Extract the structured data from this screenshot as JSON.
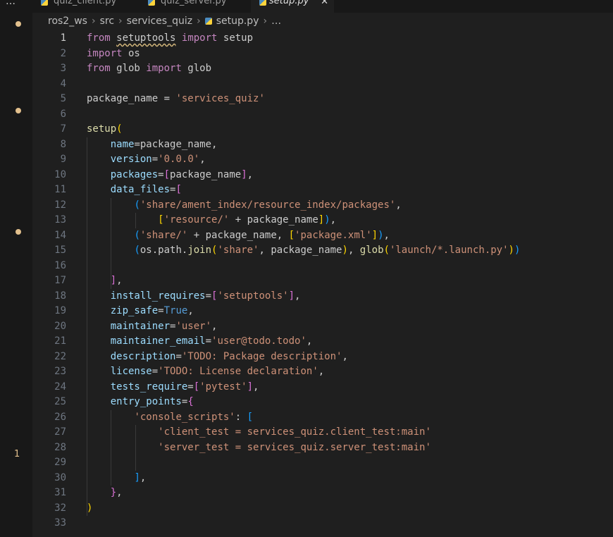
{
  "tabs": [
    {
      "name": "quiz_client.py"
    },
    {
      "name": "quiz_server.py"
    },
    {
      "name": "setup.py"
    }
  ],
  "more_label": "…",
  "close_glyph": "✕",
  "activity_badge": "1",
  "breadcrumb": [
    "ros2_ws",
    "src",
    "services_quiz",
    "setup.py",
    "…"
  ],
  "editor": {
    "current_line": 1,
    "line_numbers": [
      "1",
      "2",
      "3",
      "4",
      "5",
      "6",
      "7",
      "8",
      "9",
      "10",
      "11",
      "12",
      "13",
      "14",
      "15",
      "16",
      "17",
      "18",
      "19",
      "20",
      "21",
      "22",
      "23",
      "24",
      "25",
      "26",
      "27",
      "28",
      "29",
      "30",
      "31",
      "32",
      "33"
    ],
    "lines": [
      [
        [
          "k",
          "from"
        ],
        [
          "w",
          " "
        ],
        [
          "squig",
          "setuptools"
        ],
        [
          "w",
          " "
        ],
        [
          "k",
          "import"
        ],
        [
          "w",
          " setup"
        ]
      ],
      [
        [
          "k",
          "import"
        ],
        [
          "w",
          " os"
        ]
      ],
      [
        [
          "k",
          "from"
        ],
        [
          "w",
          " glob "
        ],
        [
          "k",
          "import"
        ],
        [
          "w",
          " glob"
        ]
      ],
      [],
      [
        [
          "w",
          "package_name = "
        ],
        [
          "s",
          "'services_quiz'"
        ]
      ],
      [],
      [
        [
          "f",
          "setup"
        ],
        [
          "b1",
          "("
        ]
      ],
      [
        [
          "w",
          "    "
        ],
        [
          "v",
          "name"
        ],
        [
          "w",
          "=package_name,"
        ]
      ],
      [
        [
          "w",
          "    "
        ],
        [
          "v",
          "version"
        ],
        [
          "w",
          "="
        ],
        [
          "s",
          "'0.0.0'"
        ],
        [
          "w",
          ","
        ]
      ],
      [
        [
          "w",
          "    "
        ],
        [
          "v",
          "packages"
        ],
        [
          "w",
          "="
        ],
        [
          "b2",
          "["
        ],
        [
          "w",
          "package_name"
        ],
        [
          "b2",
          "]"
        ],
        [
          "w",
          ","
        ]
      ],
      [
        [
          "w",
          "    "
        ],
        [
          "v",
          "data_files"
        ],
        [
          "w",
          "="
        ],
        [
          "b2",
          "["
        ]
      ],
      [
        [
          "w",
          "        "
        ],
        [
          "b3",
          "("
        ],
        [
          "s",
          "'share/ament_index/resource_index/packages'"
        ],
        [
          "w",
          ","
        ]
      ],
      [
        [
          "w",
          "            "
        ],
        [
          "b1",
          "["
        ],
        [
          "s",
          "'resource/'"
        ],
        [
          "w",
          " + package_name"
        ],
        [
          "b1",
          "]"
        ],
        [
          "b3",
          ")"
        ],
        [
          "w",
          ","
        ]
      ],
      [
        [
          "w",
          "        "
        ],
        [
          "b3",
          "("
        ],
        [
          "s",
          "'share/'"
        ],
        [
          "w",
          " + package_name, "
        ],
        [
          "b1",
          "["
        ],
        [
          "s",
          "'package.xml'"
        ],
        [
          "b1",
          "]"
        ],
        [
          "b3",
          ")"
        ],
        [
          "w",
          ","
        ]
      ],
      [
        [
          "w",
          "        "
        ],
        [
          "b3",
          "("
        ],
        [
          "w",
          "os.path."
        ],
        [
          "f",
          "join"
        ],
        [
          "b1",
          "("
        ],
        [
          "s",
          "'share'"
        ],
        [
          "w",
          ", package_name"
        ],
        [
          "b1",
          ")"
        ],
        [
          "w",
          ", "
        ],
        [
          "f",
          "glob"
        ],
        [
          "b1",
          "("
        ],
        [
          "s",
          "'launch/*.launch.py'"
        ],
        [
          "b1",
          ")"
        ],
        [
          "b3",
          ")"
        ]
      ],
      [],
      [
        [
          "w",
          "    "
        ],
        [
          "b2",
          "]"
        ],
        [
          "w",
          ","
        ]
      ],
      [
        [
          "w",
          "    "
        ],
        [
          "v",
          "install_requires"
        ],
        [
          "w",
          "="
        ],
        [
          "b2",
          "["
        ],
        [
          "s",
          "'setuptools'"
        ],
        [
          "b2",
          "]"
        ],
        [
          "w",
          ","
        ]
      ],
      [
        [
          "w",
          "    "
        ],
        [
          "v",
          "zip_safe"
        ],
        [
          "w",
          "="
        ],
        [
          "c",
          "True"
        ],
        [
          "w",
          ","
        ]
      ],
      [
        [
          "w",
          "    "
        ],
        [
          "v",
          "maintainer"
        ],
        [
          "w",
          "="
        ],
        [
          "s",
          "'user'"
        ],
        [
          "w",
          ","
        ]
      ],
      [
        [
          "w",
          "    "
        ],
        [
          "v",
          "maintainer_email"
        ],
        [
          "w",
          "="
        ],
        [
          "s",
          "'user@todo.todo'"
        ],
        [
          "w",
          ","
        ]
      ],
      [
        [
          "w",
          "    "
        ],
        [
          "v",
          "description"
        ],
        [
          "w",
          "="
        ],
        [
          "s",
          "'TODO: Package description'"
        ],
        [
          "w",
          ","
        ]
      ],
      [
        [
          "w",
          "    "
        ],
        [
          "v",
          "license"
        ],
        [
          "w",
          "="
        ],
        [
          "s",
          "'TODO: License declaration'"
        ],
        [
          "w",
          ","
        ]
      ],
      [
        [
          "w",
          "    "
        ],
        [
          "v",
          "tests_require"
        ],
        [
          "w",
          "="
        ],
        [
          "b2",
          "["
        ],
        [
          "s",
          "'pytest'"
        ],
        [
          "b2",
          "]"
        ],
        [
          "w",
          ","
        ]
      ],
      [
        [
          "w",
          "    "
        ],
        [
          "v",
          "entry_points"
        ],
        [
          "w",
          "="
        ],
        [
          "b2",
          "{"
        ]
      ],
      [
        [
          "w",
          "        "
        ],
        [
          "s",
          "'console_scripts'"
        ],
        [
          "w",
          ": "
        ],
        [
          "b3",
          "["
        ]
      ],
      [
        [
          "w",
          "            "
        ],
        [
          "s",
          "'client_test = services_quiz.client_test:main'"
        ]
      ],
      [
        [
          "w",
          "            "
        ],
        [
          "s",
          "'server_test = services_quiz.server_test:main'"
        ]
      ],
      [],
      [
        [
          "w",
          "        "
        ],
        [
          "b3",
          "]"
        ],
        [
          "w",
          ","
        ]
      ],
      [
        [
          "w",
          "    "
        ],
        [
          "b2",
          "}"
        ],
        [
          "w",
          ","
        ]
      ],
      [
        [
          "b1",
          ")"
        ]
      ],
      []
    ]
  }
}
